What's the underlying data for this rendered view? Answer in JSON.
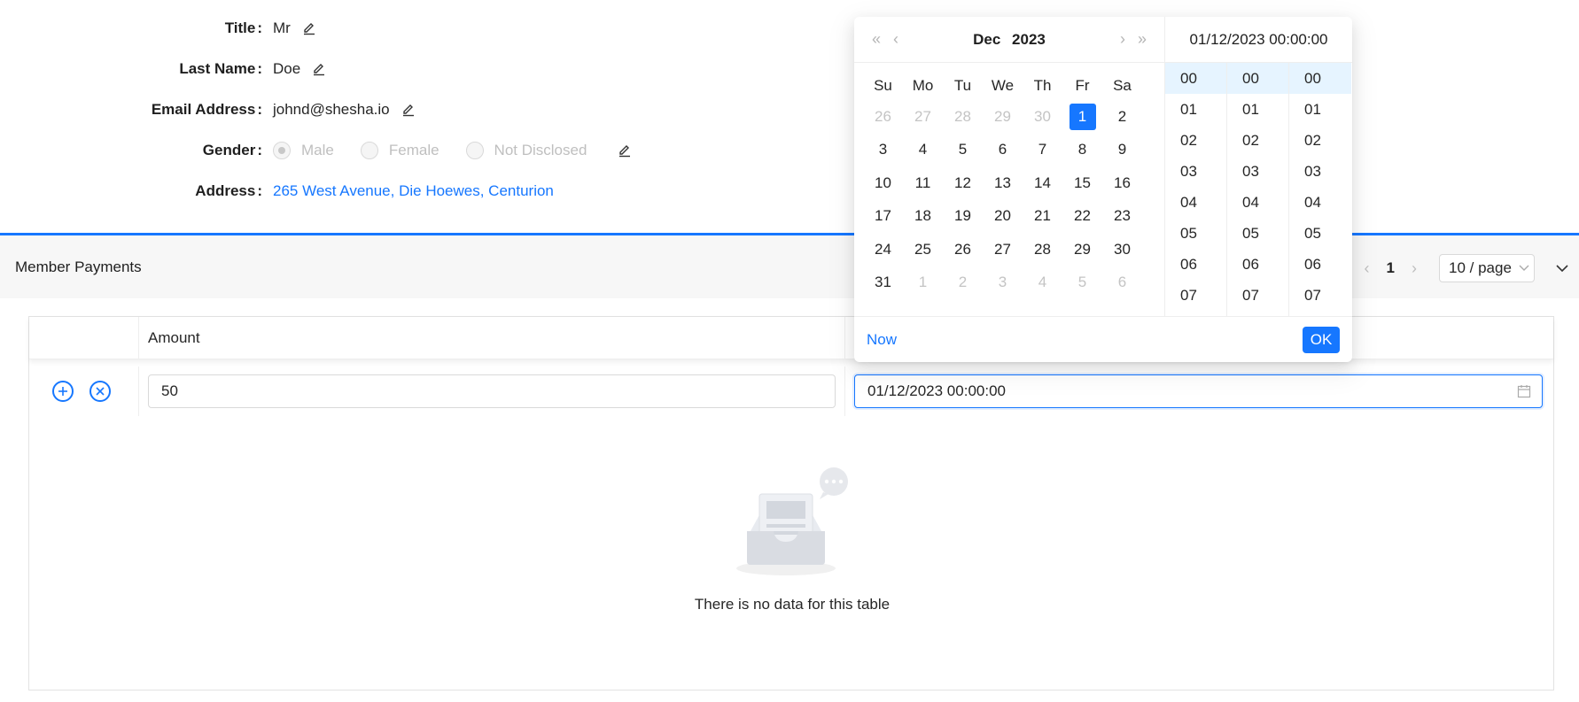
{
  "details": {
    "title": {
      "label": "Title",
      "value": "Mr"
    },
    "last_name": {
      "label": "Last Name",
      "value": "Doe"
    },
    "email": {
      "label": "Email Address",
      "value": "johnd@shesha.io"
    },
    "gender": {
      "label": "Gender",
      "options": [
        "Male",
        "Female",
        "Not Disclosed"
      ],
      "selected": "Male"
    },
    "address": {
      "label": "Address",
      "value": "265 West Avenue, Die Hoewes, Centurion"
    }
  },
  "panel": {
    "title": "Member Payments",
    "pager": {
      "current_page": "1",
      "page_size": "10 / page"
    }
  },
  "table": {
    "columns": [
      "Amount",
      ""
    ],
    "edit_row": {
      "amount": "50",
      "date": "01/12/2023 00:00:00"
    },
    "empty_text": "There is no data for this table"
  },
  "datepicker": {
    "month": "Dec",
    "year": "2023",
    "selected_datetime": "01/12/2023 00:00:00",
    "weekdays": [
      "Su",
      "Mo",
      "Tu",
      "We",
      "Th",
      "Fr",
      "Sa"
    ],
    "weeks": [
      [
        "26",
        "27",
        "28",
        "29",
        "30",
        "1",
        "2"
      ],
      [
        "3",
        "4",
        "5",
        "6",
        "7",
        "8",
        "9"
      ],
      [
        "10",
        "11",
        "12",
        "13",
        "14",
        "15",
        "16"
      ],
      [
        "17",
        "18",
        "19",
        "20",
        "21",
        "22",
        "23"
      ],
      [
        "24",
        "25",
        "26",
        "27",
        "28",
        "29",
        "30"
      ],
      [
        "31",
        "1",
        "2",
        "3",
        "4",
        "5",
        "6"
      ]
    ],
    "hours": [
      "00",
      "01",
      "02",
      "03",
      "04",
      "05",
      "06",
      "07"
    ],
    "minutes": [
      "00",
      "01",
      "02",
      "03",
      "04",
      "05",
      "06",
      "07"
    ],
    "seconds": [
      "00",
      "01",
      "02",
      "03",
      "04",
      "05",
      "06",
      "07"
    ],
    "now_label": "Now",
    "ok_label": "OK"
  },
  "colors": {
    "accent": "#1677ff",
    "panel_bg": "#f7f7f7",
    "muted_text": "#bfbfbf"
  }
}
